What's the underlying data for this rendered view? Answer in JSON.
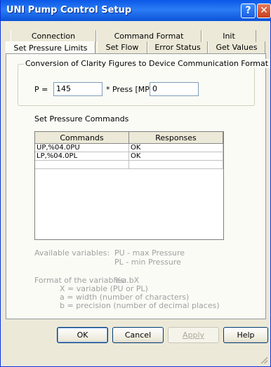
{
  "window": {
    "title": "UNI Pump Control Setup"
  },
  "titlebar_buttons": {
    "help": "?",
    "close": "✕"
  },
  "tabs_back": [
    {
      "label": "Connection"
    },
    {
      "label": "Command Format"
    },
    {
      "label": "Init"
    }
  ],
  "tabs_front": [
    {
      "label": "Set Pressure Limits",
      "active": true
    },
    {
      "label": "Set Flow"
    },
    {
      "label": "Error Status"
    },
    {
      "label": "Get Values"
    }
  ],
  "conversion": {
    "legend": "Conversion of Clarity Figures to Device Communication Format",
    "p_label": "P =",
    "p_value": "145",
    "press_label": "* Press [MPa] +",
    "offset_value": "0"
  },
  "commands_section": {
    "label": "Set Pressure Commands",
    "columns": [
      "Commands",
      "Responses"
    ],
    "rows": [
      {
        "command": "UP,%04.0PU",
        "response": "OK"
      },
      {
        "command": "LP,%04.0PL",
        "response": "OK"
      },
      {
        "command": "",
        "response": ""
      }
    ]
  },
  "info": {
    "available_label": "Available variables:",
    "var_pu": "PU - max Pressure",
    "var_pl": "PL - min Pressure",
    "format_label": "Format of the variables:",
    "format_value": "%a.bX",
    "x_desc": "X = variable (PU or PL)",
    "a_desc": "a = width (number of characters)",
    "b_desc": "b = precision (number of decimal places)"
  },
  "buttons": {
    "ok": "OK",
    "cancel": "Cancel",
    "apply": "Apply",
    "help": "Help"
  }
}
